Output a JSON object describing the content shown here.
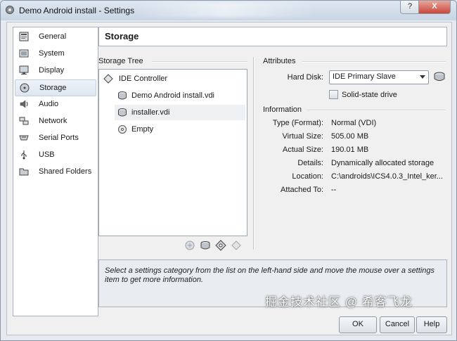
{
  "window": {
    "title": "Demo Android install - Settings",
    "help_label": "?",
    "close_label": "X"
  },
  "categories": [
    {
      "label": "General",
      "icon": "general-icon"
    },
    {
      "label": "System",
      "icon": "system-icon"
    },
    {
      "label": "Display",
      "icon": "display-icon"
    },
    {
      "label": "Storage",
      "icon": "storage-icon",
      "selected": true
    },
    {
      "label": "Audio",
      "icon": "audio-icon"
    },
    {
      "label": "Network",
      "icon": "network-icon"
    },
    {
      "label": "Serial Ports",
      "icon": "serial-ports-icon"
    },
    {
      "label": "USB",
      "icon": "usb-icon"
    },
    {
      "label": "Shared Folders",
      "icon": "shared-folders-icon"
    }
  ],
  "page": {
    "title": "Storage"
  },
  "storage_tree": {
    "label": "Storage Tree",
    "controller": "IDE Controller",
    "items": [
      {
        "label": "Demo Android install.vdi",
        "icon": "hard-disk-icon"
      },
      {
        "label": "installer.vdi",
        "icon": "hard-disk-icon",
        "selected": true
      },
      {
        "label": "Empty",
        "icon": "optical-drive-icon"
      }
    ]
  },
  "attributes": {
    "label": "Attributes",
    "hard_disk_label": "Hard Disk:",
    "hard_disk_value": "IDE Primary Slave",
    "ssd_label": "Solid-state drive",
    "ssd_checked": false
  },
  "information": {
    "label": "Information",
    "rows": [
      {
        "label": "Type (Format):",
        "value": "Normal (VDI)"
      },
      {
        "label": "Virtual Size:",
        "value": "505.00 MB"
      },
      {
        "label": "Actual Size:",
        "value": "190.01 MB"
      },
      {
        "label": "Details:",
        "value": "Dynamically allocated storage"
      },
      {
        "label": "Location:",
        "value": "C:\\androids\\ICS4.0.3_Intel_ker..."
      },
      {
        "label": "Attached To:",
        "value": "--"
      }
    ]
  },
  "info_text": "Select a settings category from the list on the left-hand side and move the mouse over a settings item to get more information.",
  "buttons": {
    "ok": "OK",
    "cancel": "Cancel",
    "help": "Help"
  },
  "watermark": "掘金技术社区 @ 希客飞龙"
}
